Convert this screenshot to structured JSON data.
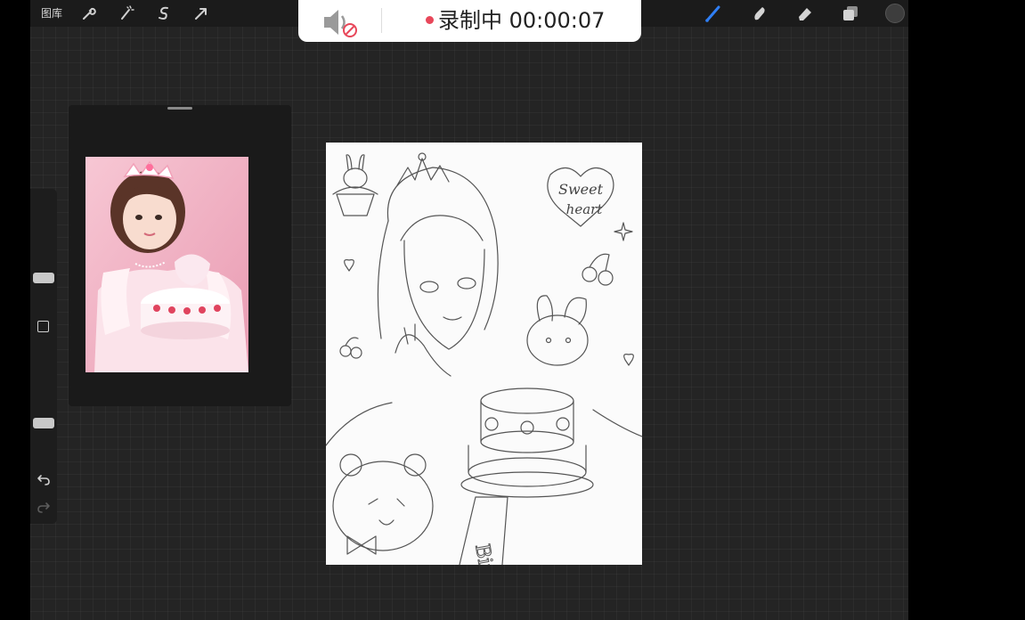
{
  "topbar": {
    "gallery_label": "图库",
    "left_tools": [
      "wrench-icon",
      "magic-wand-icon",
      "selection-s-icon",
      "transform-arrow-icon"
    ],
    "right_tools": [
      "brush-icon",
      "smudge-icon",
      "eraser-icon",
      "layers-icon"
    ],
    "active_tool": "brush-icon",
    "accent_color": "#2f7ff5",
    "current_color": "#3d3d3d"
  },
  "recording": {
    "status_text": "录制中 00:00:07",
    "dot_color": "#e8475a",
    "mic_state": "muted"
  },
  "sidebar": {
    "brush_size_level": 0.5,
    "opacity_level": 0.5
  },
  "canvas": {
    "sketch_texts": [
      "Sweet",
      "heart",
      "Birt"
    ]
  }
}
